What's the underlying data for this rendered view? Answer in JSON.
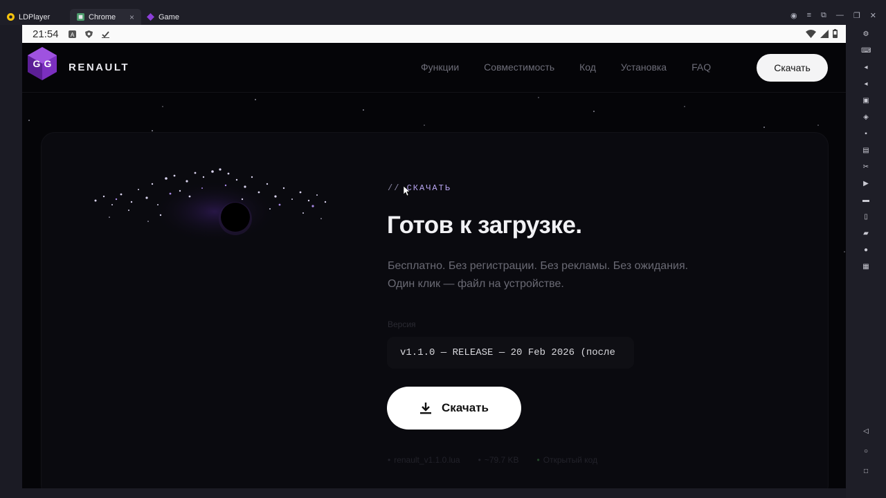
{
  "host": {
    "tabs": [
      {
        "label": "LDPlayer",
        "icon": "ldplayer-icon"
      },
      {
        "label": "Chrome",
        "icon": "chrome-icon",
        "active": true
      },
      {
        "label": "Game",
        "icon": "game-icon"
      }
    ]
  },
  "status": {
    "time": "21:54"
  },
  "nav": {
    "brand": "RENAULT",
    "links": [
      "Функции",
      "Совместимость",
      "Код",
      "Установка",
      "FAQ"
    ],
    "cta": "Скачать"
  },
  "hero": {
    "kicker_slash": "//",
    "kicker": "СКАЧАТЬ",
    "title": "Готов к загрузке.",
    "desc_line1": "Бесплатно. Без регистрации. Без рекламы. Без ожидания.",
    "desc_line2": "Один клик — файл на устройстве.",
    "version_label": "Версия",
    "version": "v1.1.0 — RELEASE — 20 Feb 2026 (после",
    "button": "Скачать",
    "meta": [
      "renault_v1.1.0.lua",
      "~79.7 KB",
      "Открытый код"
    ]
  },
  "colors": {
    "accent": "#b9a6f2",
    "logo": "#7b2fbf",
    "page_bg": "#050508"
  }
}
